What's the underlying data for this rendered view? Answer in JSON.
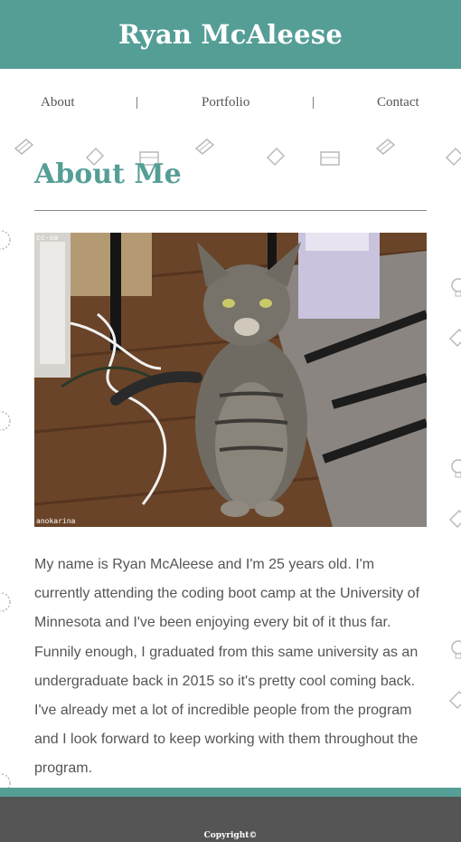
{
  "header": {
    "title": "Ryan McAleese"
  },
  "nav": {
    "items": [
      {
        "label": "About"
      },
      {
        "label": "Portfolio"
      },
      {
        "label": "Contact"
      }
    ],
    "separator": "|"
  },
  "main": {
    "heading": "About Me",
    "photo": {
      "watermark_top": "cc-sa",
      "watermark_bottom": "anokarina"
    },
    "bio": "My name is Ryan McAleese and I'm 25 years old. I'm currently attending the coding boot camp at the University of Minnesota and I've been enjoying every bit of it thus far. Funnily enough, I graduated from this same university as an undergraduate back in 2015 so it's pretty cool coming back. I've already met a lot of incredible people from the program and I look forward to keep working with them throughout the program."
  },
  "footer": {
    "copyright": "Copyright©"
  },
  "colors": {
    "accent": "#559e96",
    "footer": "#555555",
    "text": "#555555"
  },
  "icons": [
    "stapler-icon",
    "eraser-icon",
    "paper-tray-icon",
    "tape-dispenser-icon",
    "lightbulb-icon",
    "clock-icon"
  ]
}
